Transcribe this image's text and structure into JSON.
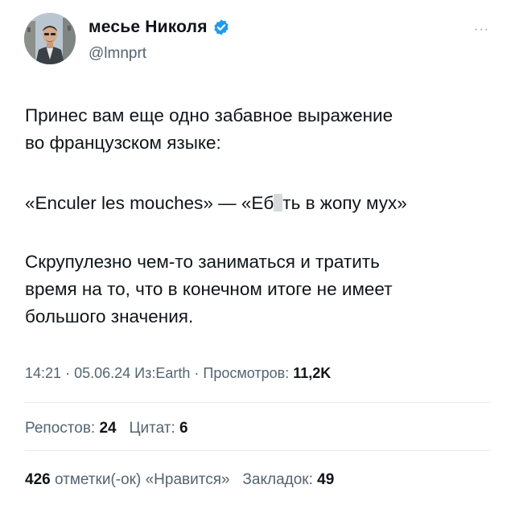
{
  "author": {
    "display_name": "месье Николя",
    "handle": "@lmnprt"
  },
  "menu": {
    "more_label": "···"
  },
  "tweet": {
    "line1": "Принес вам еще одно забавное выражение",
    "line2": "во французском языке:",
    "phrase_before": "«Enculer les mouches» — «Еб",
    "phrase_after": "ть в жопу мух»",
    "line3": "Скрупулезно чем-то заниматься и тратить",
    "line4": "время на то, что в конечном итоге не имеет",
    "line5": "большого значения."
  },
  "meta": {
    "time": "14:21",
    "date": "05.06.24",
    "source": "Из:Earth",
    "views_label": "Просмотров:",
    "views_value": "11,2K"
  },
  "stats": {
    "reposts_label": "Репостов:",
    "reposts_value": "24",
    "quotes_label": "Цитат:",
    "quotes_value": "6",
    "likes_value": "426",
    "likes_label": "отметки(-ок) «Нравится»",
    "bookmarks_label": "Закладок:",
    "bookmarks_value": "49"
  },
  "colors": {
    "verified": "#1d9bf0",
    "muted": "#536471",
    "text": "#0f1419"
  }
}
